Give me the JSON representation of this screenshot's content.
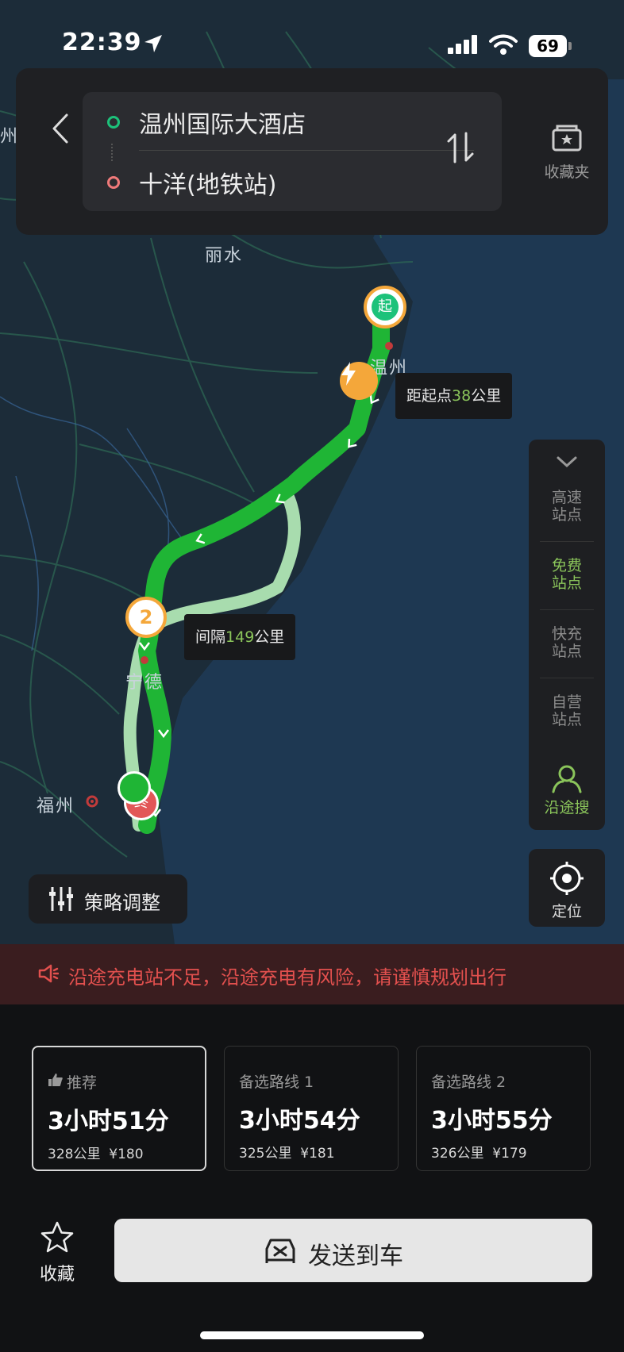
{
  "status_bar": {
    "time": "22:39",
    "battery": "69"
  },
  "route": {
    "start": "温州国际大酒店",
    "end": "十洋(地铁站)",
    "favorites_label": "收藏夹"
  },
  "map": {
    "cities": {
      "lishui": "丽水",
      "wenzhou": "温州",
      "ningde": "宁德",
      "fuzhou": "福州",
      "edge": "州"
    },
    "start_marker": "起",
    "end_marker": "终",
    "waypoint_number": "2",
    "distance_tag": {
      "prefix": "距起点",
      "value": "38",
      "suffix": "公里"
    },
    "interval_tag": {
      "prefix": "间隔",
      "value": "149",
      "suffix": "公里"
    }
  },
  "side_panel": {
    "items": [
      {
        "label": "高速站点",
        "line1": "高速",
        "line2": "站点"
      },
      {
        "label": "免费站点",
        "line1": "免费",
        "line2": "站点",
        "active": true
      },
      {
        "label": "快充站点",
        "line1": "快充",
        "line2": "站点"
      },
      {
        "label": "自营站点",
        "line1": "自营",
        "line2": "站点"
      }
    ],
    "search_label": "沿途搜",
    "locate_label": "定位"
  },
  "strategy_label": "策略调整",
  "warning": "沿途充电站不足，沿途充电有风险，请谨慎规划出行",
  "routes": [
    {
      "tag": "推荐",
      "time": "3小时51分",
      "distance": "328公里",
      "price": "¥180",
      "selected": true
    },
    {
      "tag": "备选路线 1",
      "time": "3小时54分",
      "distance": "325公里",
      "price": "¥181"
    },
    {
      "tag": "备选路线 2",
      "time": "3小时55分",
      "distance": "326公里",
      "price": "¥179"
    }
  ],
  "bottom": {
    "collect_label": "收藏",
    "send_label": "发送到车"
  },
  "colors": {
    "route_main": "#1fb535",
    "route_alt": "#a8dcae",
    "accent_green": "#8ac45a",
    "warning_red": "#e2504e"
  }
}
